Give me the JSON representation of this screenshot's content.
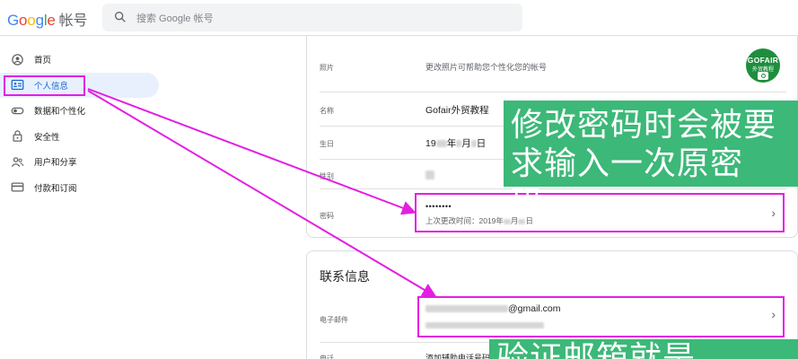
{
  "header": {
    "logo_letters": [
      "G",
      "o",
      "o",
      "g",
      "l",
      "e"
    ],
    "logo_suffix": "帐号",
    "search_placeholder": "搜索 Google 帐号"
  },
  "sidebar": {
    "items": [
      {
        "label": "首页",
        "icon": "home-icon"
      },
      {
        "label": "个人信息",
        "icon": "id-card-icon",
        "active": true
      },
      {
        "label": "数据和个性化",
        "icon": "toggle-icon"
      },
      {
        "label": "安全性",
        "icon": "lock-icon"
      },
      {
        "label": "用户和分享",
        "icon": "people-icon"
      },
      {
        "label": "付款和订阅",
        "icon": "credit-card-icon"
      }
    ]
  },
  "basic_info": {
    "photo_label": "照片",
    "photo_desc": "更改照片可帮助您个性化您的帐号",
    "avatar_text1": "GOFAIR",
    "avatar_text2": "外贸教程",
    "name_label": "名称",
    "name_value": "Gofair外贸教程",
    "birthday_label": "生日",
    "birthday_y": "19",
    "birthday_m": "年",
    "birthday_d": "月",
    "birthday_e": "日",
    "gender_label": "性别",
    "password_label": "密码",
    "password_value": "••••••••",
    "password_changed": "上次更改时间：2019年",
    "password_changed_m": "月",
    "password_changed_d": "日"
  },
  "contact_info": {
    "title": "联系信息",
    "email_label": "电子邮件",
    "email_suffix": "@gmail.com",
    "phone_label": "电话",
    "phone_value": "添加辅助电话号码"
  },
  "annotations": {
    "note1_line1": "修改密码时会被要",
    "note1_line2": "求输入一次原密码。",
    "note2_text": "验证邮箱就是……"
  },
  "colors": {
    "highlight": "#e31ee3",
    "note_bg": "#3cb878",
    "active_nav": "#e8f0fe"
  }
}
